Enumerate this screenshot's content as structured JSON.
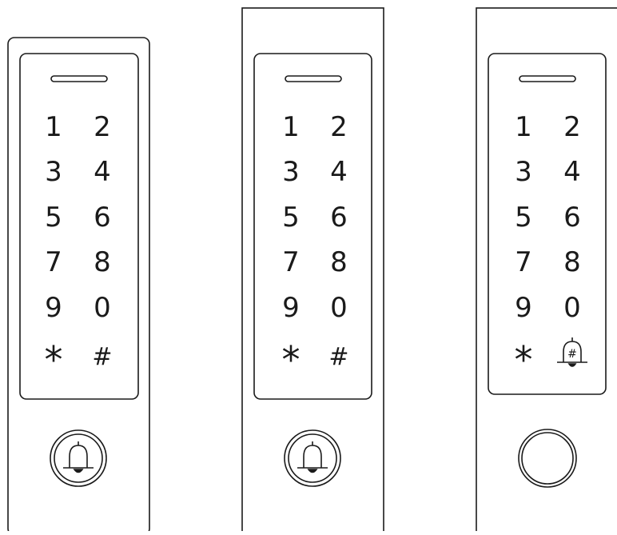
{
  "colors": {
    "stroke": "#1a1a1a",
    "background": "#ffffff"
  },
  "keypads": [
    {
      "id": "keypad-1",
      "indicator": "led-slot",
      "keys": [
        [
          "1",
          "2"
        ],
        [
          "3",
          "4"
        ],
        [
          "5",
          "6"
        ],
        [
          "7",
          "8"
        ],
        [
          "9",
          "0"
        ],
        [
          "*",
          "#"
        ]
      ],
      "bottom_button": "bell-icon"
    },
    {
      "id": "keypad-2",
      "indicator": "led-slot",
      "keys": [
        [
          "1",
          "2"
        ],
        [
          "3",
          "4"
        ],
        [
          "5",
          "6"
        ],
        [
          "7",
          "8"
        ],
        [
          "9",
          "0"
        ],
        [
          "*",
          "#"
        ]
      ],
      "bottom_button": "bell-icon"
    },
    {
      "id": "keypad-3",
      "indicator": "led-slot",
      "keys": [
        [
          "1",
          "2"
        ],
        [
          "3",
          "4"
        ],
        [
          "5",
          "6"
        ],
        [
          "7",
          "8"
        ],
        [
          "9",
          "0"
        ],
        [
          "*",
          "#"
        ]
      ],
      "hash_key_icon": "bell-with-hash-icon",
      "bottom_button": "blank-circle"
    }
  ]
}
